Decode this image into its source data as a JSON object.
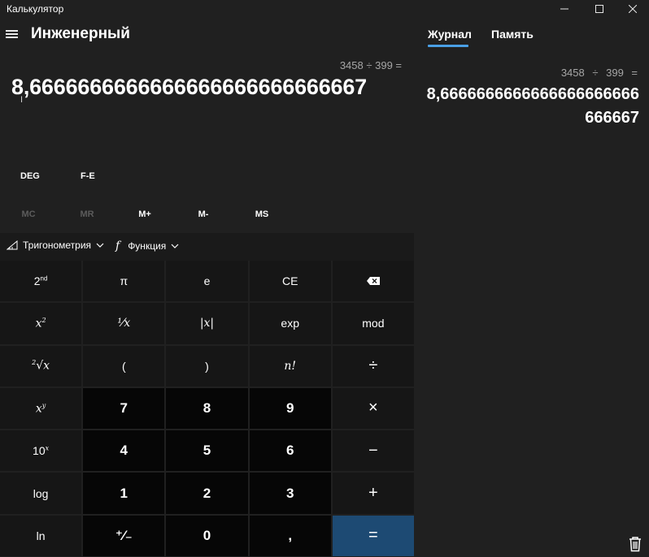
{
  "window": {
    "title": "Калькулятор",
    "controls": {
      "minimize": "minimize-icon",
      "maximize": "maximize-icon",
      "close": "close-icon"
    }
  },
  "header": {
    "mode_title": "Инженерный",
    "menu_icon": "hamburger-menu-icon"
  },
  "display": {
    "expression": "3458 ÷ 399 =",
    "result": "8,6666666666666666666666666667"
  },
  "modes": {
    "angle": "DEG",
    "fe": "F-E"
  },
  "memory": {
    "mc": "MC",
    "mr": "MR",
    "mplus": "M+",
    "mminus": "M-",
    "ms": "MS"
  },
  "func_strip": {
    "trig": "Тригонометрия",
    "func": "Функция",
    "func_glyph": "f"
  },
  "keys": [
    [
      {
        "label": "2nd"
      },
      {
        "label": "π"
      },
      {
        "label": "e"
      },
      {
        "label": "CE"
      },
      {
        "label": "backspace-icon"
      }
    ],
    [
      {
        "label": "x²"
      },
      {
        "label": "¹⁄x"
      },
      {
        "label": "|x|"
      },
      {
        "label": "exp"
      },
      {
        "label": "mod"
      }
    ],
    [
      {
        "label": "²√x"
      },
      {
        "label": "("
      },
      {
        "label": ")"
      },
      {
        "label": "n!"
      },
      {
        "label": "÷"
      }
    ],
    [
      {
        "label": "xʸ"
      },
      {
        "label": "7"
      },
      {
        "label": "8"
      },
      {
        "label": "9"
      },
      {
        "label": "×"
      }
    ],
    [
      {
        "label": "10ˣ"
      },
      {
        "label": "4"
      },
      {
        "label": "5"
      },
      {
        "label": "6"
      },
      {
        "label": "−"
      }
    ],
    [
      {
        "label": "log"
      },
      {
        "label": "1"
      },
      {
        "label": "2"
      },
      {
        "label": "3"
      },
      {
        "label": "+"
      }
    ],
    [
      {
        "label": "ln"
      },
      {
        "label": "⁺⁄₋"
      },
      {
        "label": "0"
      },
      {
        "label": ","
      },
      {
        "label": "="
      }
    ]
  ],
  "history_panel": {
    "tabs": [
      {
        "label": "Журнал",
        "active": true
      },
      {
        "label": "Память",
        "active": false
      }
    ],
    "entries": [
      {
        "expression": "3458 ÷ 399 =",
        "result": "8,6666666666666666666666666667"
      }
    ],
    "delete_icon": "trash-icon"
  },
  "colors": {
    "background": "#202020",
    "accent": "#4aa0e6",
    "equals": "#1d4a73"
  }
}
